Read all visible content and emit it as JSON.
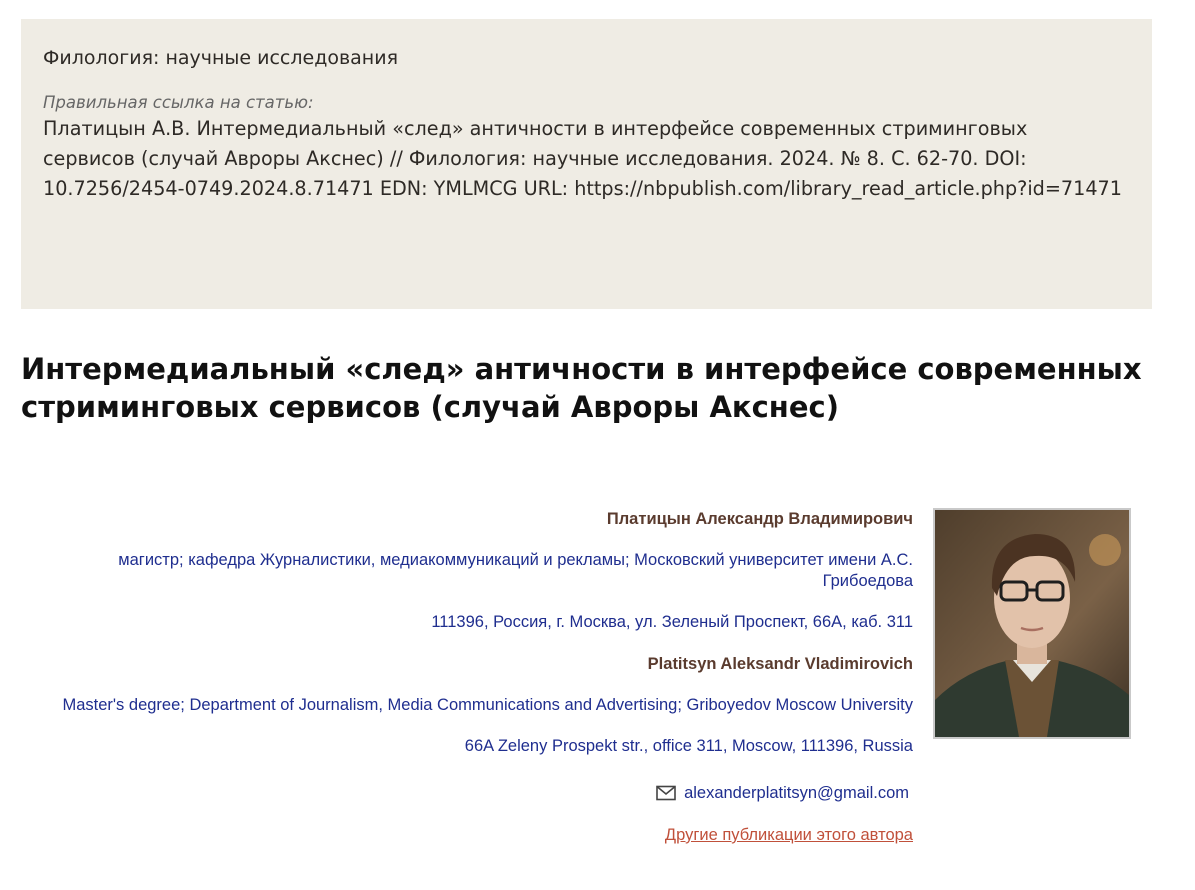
{
  "citation": {
    "journal": "Филология: научные исследования",
    "label": "Правильная ссылка на статью:",
    "text": "Платицын А.В.  Интермедиальный «след» античности в интерфейсе современных стриминговых сервисов (случай Авроры Акснес) // Филология: научные исследования.  2024. № 8.  С. 62-70. DOI: 10.7256/2454-0749.2024.8.71471 EDN: YMLMCG URL: https://nbpublish.com/library_read_article.php?id=71471"
  },
  "article": {
    "title": "Интермедиальный «след» античности в интерфейсе современных стриминговых сервисов (случай Авроры Акснес)"
  },
  "author": {
    "name_ru": "Платицын Александр Владимирович",
    "affiliation_ru": "магистр; кафедра Журналистики, медиакоммуникаций и рекламы; Московский университет имени А.С. Грибоедова",
    "address_ru": "111396, Россия, г. Москва, ул. Зеленый Проспект, 66А, каб. 311",
    "name_en": "Platitsyn Aleksandr Vladimirovich",
    "affiliation_en": "Master's degree; Department of Journalism, Media Communications and Advertising; Griboyedov Moscow University",
    "address_en": "66A Zeleny Prospekt str., office 311, Moscow, 111396, Russia",
    "email": "alexanderplatitsyn@gmail.com",
    "email_icon": "envelope-icon",
    "other_publications_link": "Другие публикации этого автора"
  },
  "colors": {
    "citation_bg": "#efece4",
    "author_name": "#5a3b2e",
    "info_text": "#1f2e8f",
    "link": "#c0503a"
  }
}
